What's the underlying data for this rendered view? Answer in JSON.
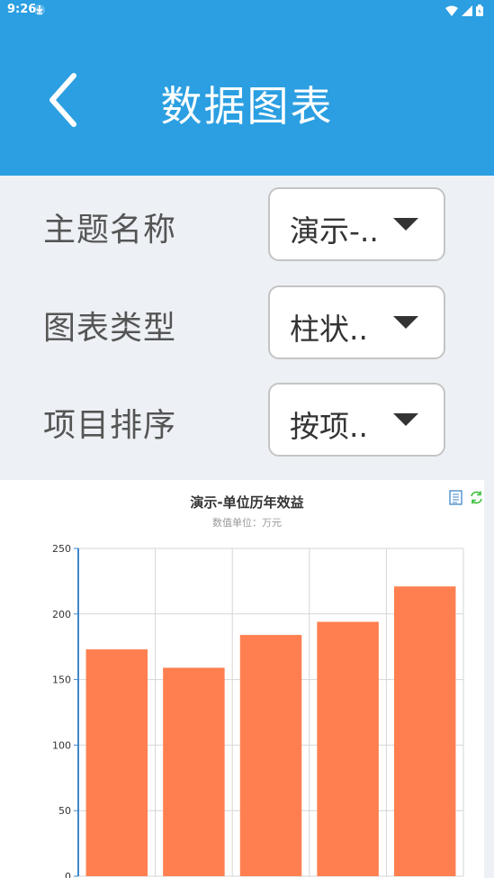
{
  "status_bar": {
    "time": "9:26"
  },
  "header": {
    "title": "数据图表"
  },
  "form": {
    "rows": [
      {
        "label": "主题名称",
        "value": "演示-.."
      },
      {
        "label": "图表类型",
        "value": "柱状.."
      },
      {
        "label": "项目排序",
        "value": "按项.."
      }
    ]
  },
  "chart": {
    "toolbox": [
      "data-view-icon",
      "refresh-icon"
    ]
  },
  "colors": {
    "primary": "#2b9fe1",
    "bar": "#ff7f50",
    "background": "#edf1f5"
  },
  "chart_data": {
    "type": "bar",
    "title": "演示-单位历年效益",
    "subtitle": "数值单位：万元",
    "categories": [
      "",
      "",
      "",
      "",
      ""
    ],
    "series": [
      {
        "values": [
          173,
          159,
          184,
          194,
          221
        ]
      }
    ],
    "ylim": [
      0,
      250
    ],
    "yticks": [
      0,
      50,
      100,
      150,
      200,
      250
    ],
    "grid": true
  }
}
